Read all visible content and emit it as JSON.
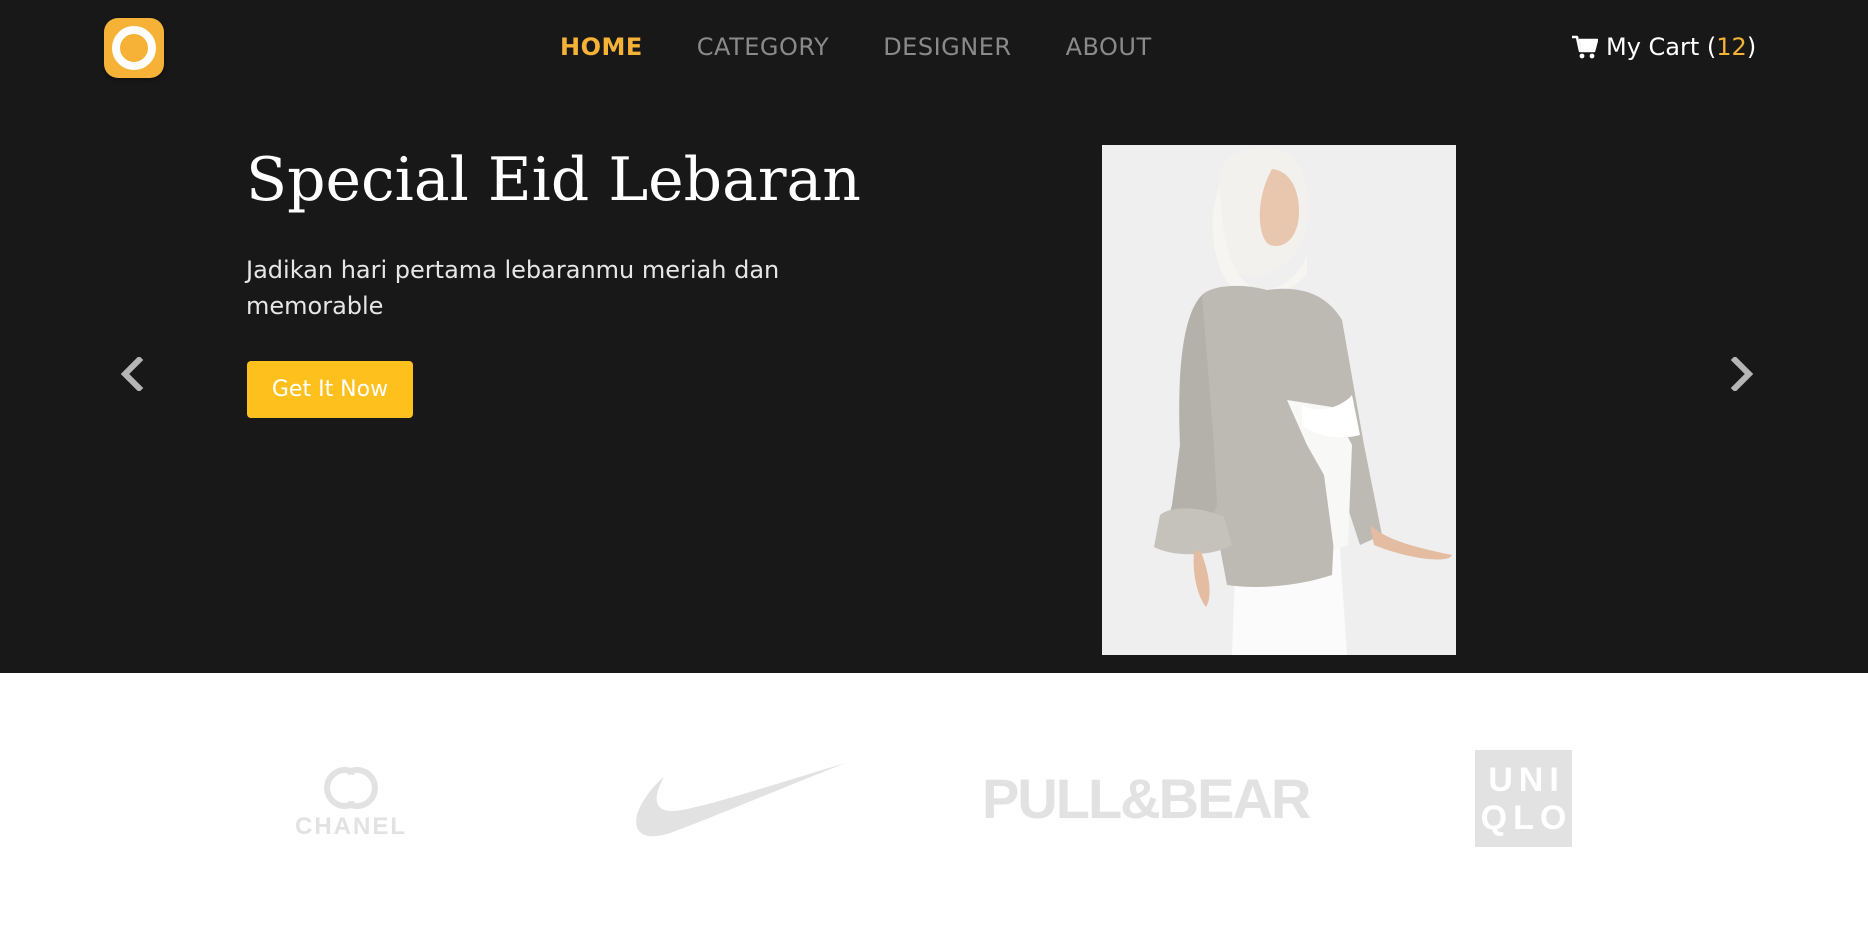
{
  "header": {
    "logo_icon": "logo-ring-icon",
    "nav": [
      {
        "label": "HOME",
        "active": true
      },
      {
        "label": "CATEGORY",
        "active": false
      },
      {
        "label": "DESIGNER",
        "active": false
      },
      {
        "label": "ABOUT",
        "active": false
      }
    ],
    "cart": {
      "icon": "cart-icon",
      "label": "My Cart (",
      "count": "12",
      "close": ")"
    }
  },
  "hero": {
    "title": "Special Eid Lebaran",
    "subtitle": "Jadikan hari pertama lebaranmu meriah dan memorable",
    "cta_label": "Get It Now",
    "prev_icon": "chevron-left-icon",
    "next_icon": "chevron-right-icon"
  },
  "brands": {
    "chanel_text": "CHANEL",
    "pullbear_text": "PULL&BEAR",
    "uniqlo_line1": "UNI",
    "uniqlo_line2": "QLO"
  },
  "colors": {
    "accent": "#f5b236",
    "cta": "#fdc01d",
    "hero_bg": "#181818",
    "brand_logo": "#e2e2e2"
  }
}
